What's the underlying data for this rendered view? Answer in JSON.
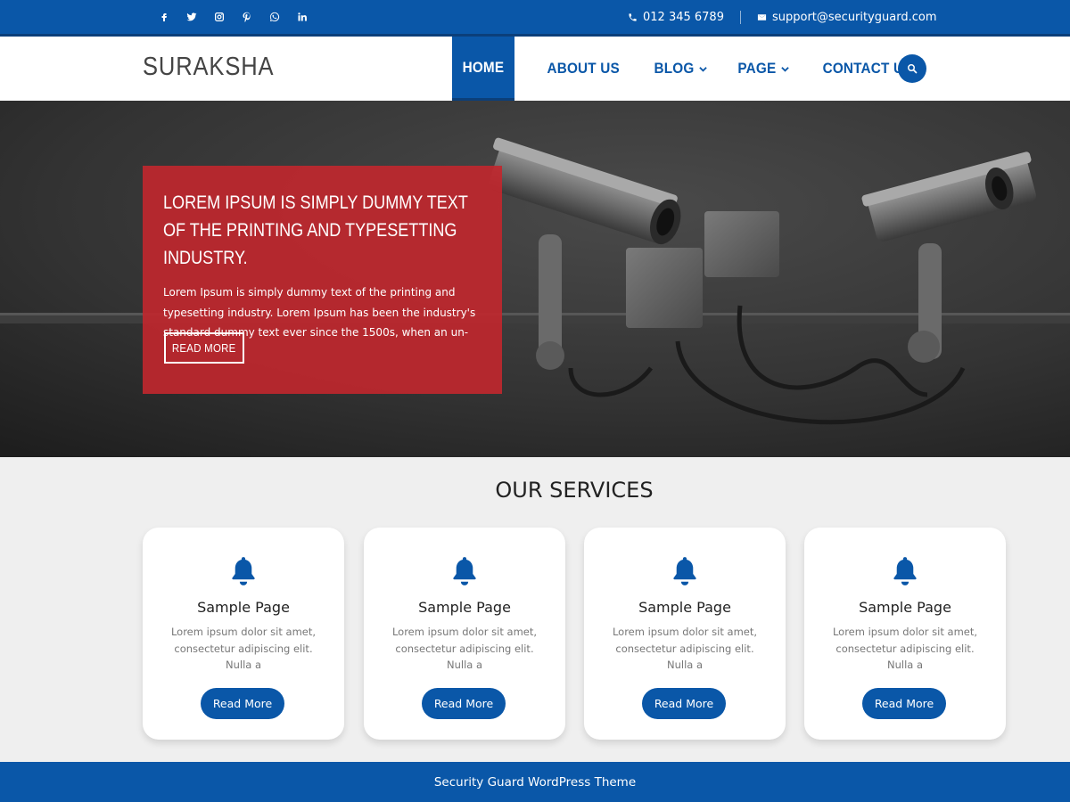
{
  "topbar": {
    "social": [
      {
        "icon": "facebook-icon"
      },
      {
        "icon": "twitter-icon"
      },
      {
        "icon": "instagram-icon"
      },
      {
        "icon": "pinterest-icon"
      },
      {
        "icon": "whatsapp-icon"
      },
      {
        "icon": "linkedin-icon"
      }
    ],
    "phone": "012 345 6789",
    "email": "support@securityguard.com",
    "phone_icon": "phone-icon",
    "email_icon": "envelope-icon"
  },
  "header": {
    "logo": "SURAKSHA",
    "nav": [
      {
        "label": "HOME",
        "active": true
      },
      {
        "label": "ABOUT US"
      },
      {
        "label": "BLOG",
        "dropdown": true
      },
      {
        "label": "PAGE",
        "dropdown": true
      },
      {
        "label": "CONTACT US"
      }
    ],
    "search_icon": "search-icon"
  },
  "hero": {
    "title": "LOREM IPSUM IS SIMPLY DUMMY TEXT OF THE PRINTING AND TYPESETTING INDUSTRY.",
    "text": "Lorem Ipsum is simply dummy text of the printing and typesetting industry. Lorem Ipsum has been the industry's standard dummy text ever since the 1500s, when an un-",
    "button": "READ MORE"
  },
  "services": {
    "title": "OUR SERVICES",
    "cards": [
      {
        "icon": "bell-icon",
        "title": "Sample Page",
        "text": "Lorem ipsum dolor sit amet, consectetur adipiscing elit. Nulla a",
        "button": "Read More"
      },
      {
        "icon": "bell-icon",
        "title": "Sample Page",
        "text": "Lorem ipsum dolor sit amet, consectetur adipiscing elit. Nulla a",
        "button": "Read More"
      },
      {
        "icon": "bell-icon",
        "title": "Sample Page",
        "text": "Lorem ipsum dolor sit amet, consectetur adipiscing elit. Nulla a",
        "button": "Read More"
      },
      {
        "icon": "bell-icon",
        "title": "Sample Page",
        "text": "Lorem ipsum dolor sit amet, consectetur adipiscing elit. Nulla a",
        "button": "Read More"
      }
    ]
  },
  "footer": {
    "text": "Security Guard WordPress Theme"
  },
  "colors": {
    "brand_blue": "#0a57a8",
    "hero_red": "#c2272d"
  }
}
